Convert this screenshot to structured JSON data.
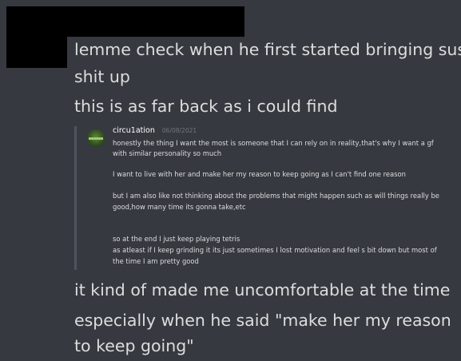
{
  "messages_before": [
    {
      "line1": "lemme check when he first started bringing sus",
      "line2": "shit up"
    },
    {
      "line1": "this is as far back as i could find"
    }
  ],
  "quote": {
    "author": "circu1ation",
    "timestamp": "06/08/2021",
    "lines": [
      "honestly the thing I want the most is someone that I can rely on in reality,that's why I want a gf",
      "with similar personality so much",
      "I want to live with her and make her my reason to keep going as I can't find one reason",
      "but I am also like not thinking about the problems that might happen such as will things really be",
      "good,how many time its gonna take,etc",
      "so at the end I just keep playing tetris",
      "as atleast if I keep grinding it its just sometimes I lost motivation and feel s bit down but most of",
      "the time I am pretty good"
    ]
  },
  "messages_after": [
    {
      "line1": "it kind of made me uncomfortable at the time"
    },
    {
      "line1": "especially when he said \"make her my reason",
      "line2": "to keep going\""
    }
  ]
}
